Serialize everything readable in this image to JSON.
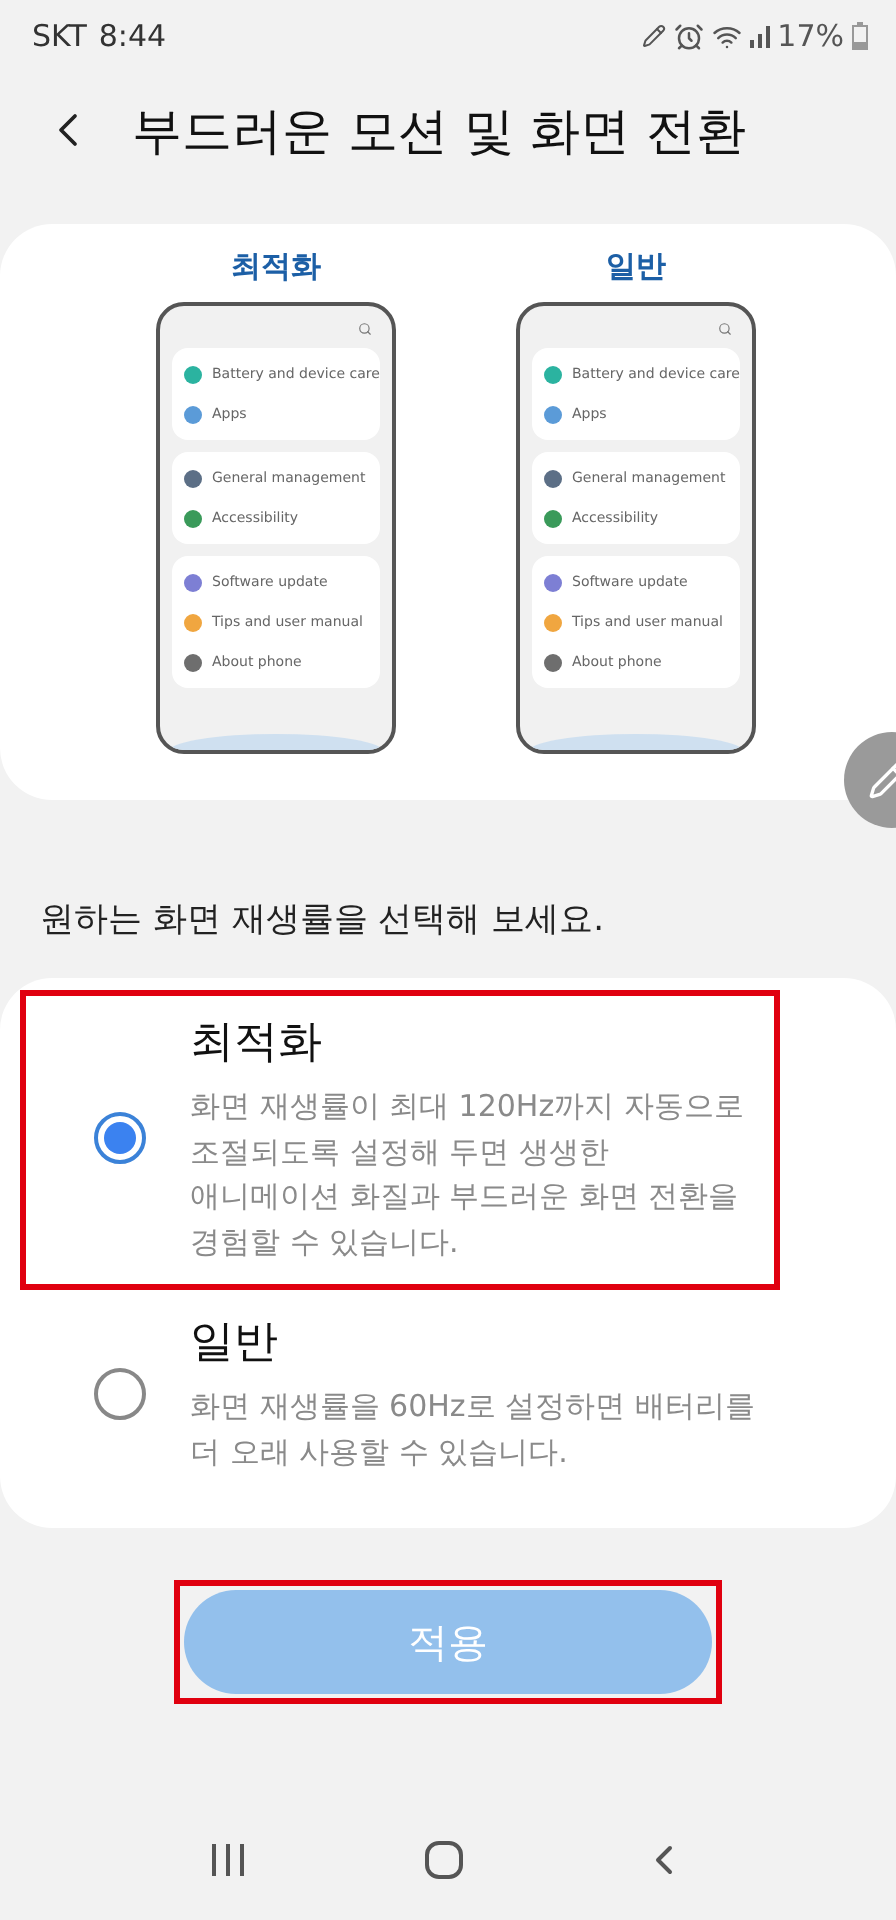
{
  "status_bar": {
    "carrier": "SKT",
    "time": "8:44",
    "battery": "17%"
  },
  "header": {
    "title": "부드러운 모션 및 화면 전환"
  },
  "preview": {
    "mockups": [
      {
        "label": "최적화",
        "groups": [
          [
            {
              "text": "Battery and device care",
              "color": "#2bb3a0"
            },
            {
              "text": "Apps",
              "color": "#5b9bd8"
            }
          ],
          [
            {
              "text": "General management",
              "color": "#5c6f86"
            },
            {
              "text": "Accessibility",
              "color": "#3a9a5a"
            }
          ],
          [
            {
              "text": "Software update",
              "color": "#7d7fd4"
            },
            {
              "text": "Tips and user manual",
              "color": "#f0a640"
            },
            {
              "text": "About phone",
              "color": "#6e6e6e"
            }
          ]
        ]
      },
      {
        "label": "일반",
        "groups": [
          [
            {
              "text": "Battery and device care",
              "color": "#2bb3a0"
            },
            {
              "text": "Apps",
              "color": "#5b9bd8"
            }
          ],
          [
            {
              "text": "General management",
              "color": "#5c6f86"
            },
            {
              "text": "Accessibility",
              "color": "#3a9a5a"
            }
          ],
          [
            {
              "text": "Software update",
              "color": "#7d7fd4"
            },
            {
              "text": "Tips and user manual",
              "color": "#f0a640"
            },
            {
              "text": "About phone",
              "color": "#6e6e6e"
            }
          ]
        ]
      }
    ]
  },
  "prompt": "원하는 화면 재생률을 선택해 보세요.",
  "options": [
    {
      "title": "최적화",
      "description": "화면 재생률이 최대 120Hz까지 자동으로 조절되도록 설정해 두면 생생한 애니메이션 화질과 부드러운 화면 전환을 경험할 수 있습니다.",
      "selected": true,
      "highlighted": true
    },
    {
      "title": "일반",
      "description": "화면 재생률을 60Hz로 설정하면 배터리를 더 오래 사용할 수 있습니다.",
      "selected": false,
      "highlighted": false
    }
  ],
  "apply_button": {
    "label": "적용",
    "highlighted": true
  }
}
